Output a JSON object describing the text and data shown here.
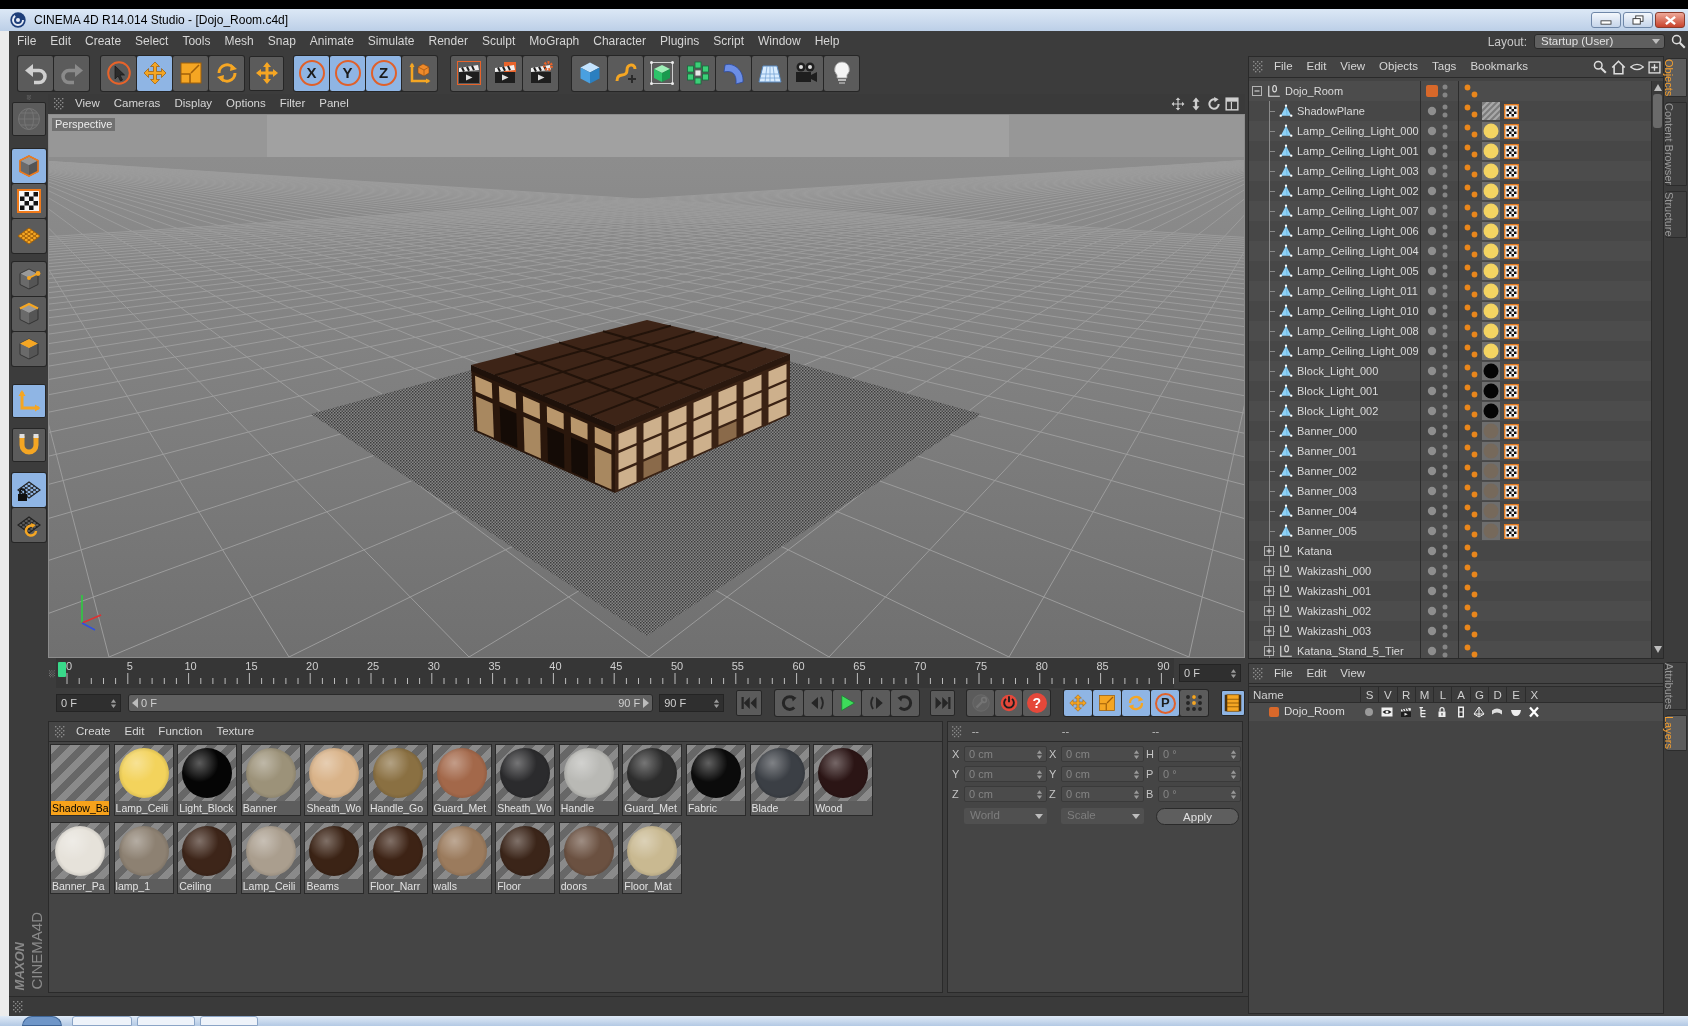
{
  "window": {
    "title": "CINEMA 4D R14.014 Studio - [Dojo_Room.c4d]"
  },
  "menu_bar": [
    "File",
    "Edit",
    "Create",
    "Select",
    "Tools",
    "Mesh",
    "Snap",
    "Animate",
    "Simulate",
    "Render",
    "Sculpt",
    "MoGraph",
    "Character",
    "Plugins",
    "Script",
    "Window",
    "Help"
  ],
  "layout": {
    "label": "Layout:",
    "value": "Startup (User)"
  },
  "main_toolbar": [
    [
      {
        "kind": "undo",
        "on": false,
        "disabled": false
      },
      {
        "kind": "redo",
        "on": false,
        "disabled": true
      }
    ],
    [
      {
        "kind": "select",
        "on": false,
        "disabled": false
      },
      {
        "kind": "move",
        "on": true,
        "disabled": false
      },
      {
        "kind": "scale",
        "on": false,
        "disabled": false
      },
      {
        "kind": "rotate",
        "on": false,
        "disabled": false
      }
    ],
    [
      {
        "kind": "addmove",
        "on": false,
        "disabled": false
      }
    ],
    [
      {
        "kind": "axis",
        "label": "X",
        "on": true,
        "disabled": false
      },
      {
        "kind": "axis",
        "label": "Y",
        "on": true,
        "disabled": false
      },
      {
        "kind": "axis",
        "label": "Z",
        "on": true,
        "disabled": false
      },
      {
        "kind": "coords",
        "on": false,
        "disabled": false
      }
    ],
    [
      {
        "kind": "renderview",
        "on": false,
        "disabled": false
      },
      {
        "kind": "renderpicture",
        "on": false,
        "disabled": false
      },
      {
        "kind": "rendersettings",
        "on": false,
        "disabled": false
      }
    ],
    [
      {
        "kind": "cube",
        "on": false,
        "disabled": false
      },
      {
        "kind": "pen",
        "on": false,
        "disabled": false
      },
      {
        "kind": "subdivision",
        "on": false,
        "disabled": false
      },
      {
        "kind": "cloner",
        "on": false,
        "disabled": false
      },
      {
        "kind": "deformer",
        "on": false,
        "disabled": false
      },
      {
        "kind": "floor",
        "on": false,
        "disabled": false
      },
      {
        "kind": "camera",
        "on": false,
        "disabled": false
      },
      {
        "kind": "light",
        "on": false,
        "disabled": false
      }
    ]
  ],
  "left_toolbar": [
    [
      {
        "kind": "editable",
        "on": false,
        "disabled": true
      }
    ],
    [
      {
        "kind": "model",
        "on": true,
        "disabled": false
      },
      {
        "kind": "texture",
        "on": false,
        "disabled": false
      },
      {
        "kind": "workplane",
        "on": false,
        "disabled": false
      }
    ],
    [
      {
        "kind": "points",
        "on": false,
        "disabled": false
      },
      {
        "kind": "edges",
        "on": false,
        "disabled": false
      },
      {
        "kind": "polygons",
        "on": false,
        "disabled": false
      }
    ],
    [
      {
        "kind": "axes",
        "on": true,
        "disabled": false
      }
    ],
    [
      {
        "kind": "snap",
        "on": false,
        "disabled": false
      }
    ],
    [
      {
        "kind": "lockplane",
        "on": true,
        "disabled": false
      },
      {
        "kind": "sync",
        "on": false,
        "disabled": false
      }
    ]
  ],
  "viewport": {
    "menu": [
      "View",
      "Cameras",
      "Display",
      "Options",
      "Filter",
      "Panel"
    ],
    "camera": "Perspective"
  },
  "timeline": {
    "ticks": [
      "0",
      "5",
      "10",
      "15",
      "20",
      "25",
      "30",
      "35",
      "40",
      "45",
      "50",
      "55",
      "60",
      "65",
      "70",
      "75",
      "80",
      "85",
      "90"
    ],
    "level": 0,
    "frame_field": "0 F"
  },
  "frame_controls": {
    "start_field": "0 F",
    "range": {
      "start": "0 F",
      "end": "90 F",
      "level": 1
    },
    "end_field": "90 F",
    "groups": [
      [
        {
          "kind": "start",
          "on": false,
          "disabled": false
        }
      ],
      [
        {
          "kind": "loopback",
          "on": false,
          "disabled": false
        },
        {
          "kind": "stepback",
          "on": false,
          "disabled": false
        },
        {
          "kind": "play",
          "on": false,
          "disabled": false
        },
        {
          "kind": "stepforward",
          "on": false,
          "disabled": false
        },
        {
          "kind": "loopforward",
          "on": false,
          "disabled": false
        }
      ],
      [
        {
          "kind": "end",
          "on": false,
          "disabled": false
        }
      ],
      [
        {
          "kind": "keyframe",
          "on": false,
          "disabled": true
        },
        {
          "kind": "record",
          "on": false,
          "disabled": false
        },
        {
          "kind": "autokey",
          "label": "?",
          "on": false,
          "disabled": false
        }
      ],
      [
        {
          "kind": "keymove",
          "on": true,
          "disabled": false
        },
        {
          "kind": "keyscale",
          "on": true,
          "disabled": false
        },
        {
          "kind": "keyrotate",
          "on": true,
          "disabled": false
        },
        {
          "kind": "keyparam",
          "label": "P",
          "on": true,
          "disabled": false
        },
        {
          "kind": "keypoints",
          "on": false,
          "disabled": false
        }
      ],
      [
        {
          "kind": "timeline",
          "on": true,
          "disabled": false
        }
      ]
    ]
  },
  "materials": {
    "menu": [
      "Create",
      "Edit",
      "Function",
      "Texture"
    ],
    "items": [
      {
        "name": "Shadow_Ba",
        "selected": true
      },
      {
        "name": "Lamp_Ceili",
        "selected": false,
        "color": "#f3d35c"
      },
      {
        "name": "Light_Block",
        "selected": false,
        "color": "#050505"
      },
      {
        "name": "Banner",
        "selected": false,
        "color": "#9c9279"
      },
      {
        "name": "Sheath_Wo",
        "selected": false,
        "color": "#d9b389"
      },
      {
        "name": "Handle_Go",
        "selected": false,
        "color": "#8a7042"
      },
      {
        "name": "Guard_Met",
        "selected": false,
        "color": "#a3684a"
      },
      {
        "name": "Sheath_Wo",
        "selected": false,
        "color": "#2b2b2d"
      },
      {
        "name": "Handle",
        "selected": false,
        "color": "#b9b9b5"
      },
      {
        "name": "Guard_Met",
        "selected": false,
        "color": "#2d2d2d"
      },
      {
        "name": "Fabric",
        "selected": false,
        "color": "#0b0b0b"
      },
      {
        "name": "Blade",
        "selected": false,
        "color": "#3b3f45"
      },
      {
        "name": "Wood",
        "selected": false,
        "color": "#2b1515"
      },
      {
        "name": "Banner_Pa",
        "selected": false,
        "color": "#e6e2da"
      },
      {
        "name": "lamp_1",
        "selected": false,
        "color": "#8d8172"
      },
      {
        "name": "Ceiling",
        "selected": false,
        "color": "#3d2519"
      },
      {
        "name": "Lamp_Ceili",
        "selected": false,
        "color": "#aa9e8e"
      },
      {
        "name": "Beams",
        "selected": false,
        "color": "#3b2315"
      },
      {
        "name": "Floor_Narr",
        "selected": false,
        "color": "#3d2315"
      },
      {
        "name": "walls",
        "selected": false,
        "color": "#9b7b5d"
      },
      {
        "name": "Floor",
        "selected": false,
        "color": "#3b2519"
      },
      {
        "name": "doors",
        "selected": false,
        "color": "#6b5141"
      },
      {
        "name": "Floor_Mat",
        "selected": false,
        "color": "#c9b991"
      }
    ]
  },
  "coordinates": {
    "columns": [
      {
        "header": "--",
        "fields": [
          {
            "label": "X",
            "value": "0 cm",
            "disabled": true
          },
          {
            "label": "Y",
            "value": "0 cm",
            "disabled": true
          },
          {
            "label": "Z",
            "value": "0 cm",
            "disabled": true
          }
        ],
        "control": {
          "kind": "dropdown",
          "value": "World",
          "disabled": true
        }
      },
      {
        "header": "--",
        "fields": [
          {
            "label": "X",
            "value": "0 cm",
            "disabled": true
          },
          {
            "label": "Y",
            "value": "0 cm",
            "disabled": true
          },
          {
            "label": "Z",
            "value": "0 cm",
            "disabled": true
          }
        ],
        "control": {
          "kind": "dropdown",
          "value": "Scale",
          "disabled": true
        }
      },
      {
        "header": "--",
        "fields": [
          {
            "label": "H",
            "value": "0 °",
            "disabled": true
          },
          {
            "label": "P",
            "value": "0 °",
            "disabled": true
          },
          {
            "label": "B",
            "value": "0 °",
            "disabled": true
          }
        ],
        "control": {
          "kind": "button",
          "value": "Apply",
          "disabled": false
        }
      }
    ]
  },
  "objects": {
    "menu": [
      "File",
      "Edit",
      "View",
      "Objects",
      "Tags",
      "Bookmarks"
    ],
    "tree": [
      {
        "name": "Dojo_Room",
        "kind": "null",
        "expanded": true,
        "color": "#d8682a",
        "tags": [
          {
            "kind": "phong"
          }
        ],
        "children": [
          {
            "name": "ShadowPlane",
            "kind": "polygon",
            "tags": [
              {
                "kind": "phong"
              },
              {
                "kind": "shadow"
              },
              {
                "kind": "texture"
              }
            ]
          },
          {
            "name": "Lamp_Ceiling_Light_000",
            "kind": "polygon",
            "tags": [
              {
                "kind": "phong"
              },
              {
                "kind": "material",
                "color": "#f4d462"
              },
              {
                "kind": "texture"
              }
            ]
          },
          {
            "name": "Lamp_Ceiling_Light_001",
            "kind": "polygon",
            "tags": [
              {
                "kind": "phong"
              },
              {
                "kind": "material",
                "color": "#f4d462"
              },
              {
                "kind": "texture"
              }
            ]
          },
          {
            "name": "Lamp_Ceiling_Light_003",
            "kind": "polygon",
            "tags": [
              {
                "kind": "phong"
              },
              {
                "kind": "material",
                "color": "#f4d462"
              },
              {
                "kind": "texture"
              }
            ]
          },
          {
            "name": "Lamp_Ceiling_Light_002",
            "kind": "polygon",
            "tags": [
              {
                "kind": "phong"
              },
              {
                "kind": "material",
                "color": "#f4d462"
              },
              {
                "kind": "texture"
              }
            ]
          },
          {
            "name": "Lamp_Ceiling_Light_007",
            "kind": "polygon",
            "tags": [
              {
                "kind": "phong"
              },
              {
                "kind": "material",
                "color": "#f4d462"
              },
              {
                "kind": "texture"
              }
            ]
          },
          {
            "name": "Lamp_Ceiling_Light_006",
            "kind": "polygon",
            "tags": [
              {
                "kind": "phong"
              },
              {
                "kind": "material",
                "color": "#f4d462"
              },
              {
                "kind": "texture"
              }
            ]
          },
          {
            "name": "Lamp_Ceiling_Light_004",
            "kind": "polygon",
            "tags": [
              {
                "kind": "phong"
              },
              {
                "kind": "material",
                "color": "#f4d462"
              },
              {
                "kind": "texture"
              }
            ]
          },
          {
            "name": "Lamp_Ceiling_Light_005",
            "kind": "polygon",
            "tags": [
              {
                "kind": "phong"
              },
              {
                "kind": "material",
                "color": "#f4d462"
              },
              {
                "kind": "texture"
              }
            ]
          },
          {
            "name": "Lamp_Ceiling_Light_011",
            "kind": "polygon",
            "tags": [
              {
                "kind": "phong"
              },
              {
                "kind": "material",
                "color": "#f4d462"
              },
              {
                "kind": "texture"
              }
            ]
          },
          {
            "name": "Lamp_Ceiling_Light_010",
            "kind": "polygon",
            "tags": [
              {
                "kind": "phong"
              },
              {
                "kind": "material",
                "color": "#f4d462"
              },
              {
                "kind": "texture"
              }
            ]
          },
          {
            "name": "Lamp_Ceiling_Light_008",
            "kind": "polygon",
            "tags": [
              {
                "kind": "phong"
              },
              {
                "kind": "material",
                "color": "#f4d462"
              },
              {
                "kind": "texture"
              }
            ]
          },
          {
            "name": "Lamp_Ceiling_Light_009",
            "kind": "polygon",
            "tags": [
              {
                "kind": "phong"
              },
              {
                "kind": "material",
                "color": "#f4d462"
              },
              {
                "kind": "texture"
              }
            ]
          },
          {
            "name": "Block_Light_000",
            "kind": "polygon",
            "tags": [
              {
                "kind": "phong"
              },
              {
                "kind": "material",
                "color": "#050505"
              },
              {
                "kind": "texture"
              }
            ]
          },
          {
            "name": "Block_Light_001",
            "kind": "polygon",
            "tags": [
              {
                "kind": "phong"
              },
              {
                "kind": "material",
                "color": "#050505"
              },
              {
                "kind": "texture"
              }
            ]
          },
          {
            "name": "Block_Light_002",
            "kind": "polygon",
            "tags": [
              {
                "kind": "phong"
              },
              {
                "kind": "material",
                "color": "#050505"
              },
              {
                "kind": "texture"
              }
            ]
          },
          {
            "name": "Banner_000",
            "kind": "polygon",
            "tags": [
              {
                "kind": "phong"
              },
              {
                "kind": "material",
                "color": "#76695b"
              },
              {
                "kind": "texture"
              }
            ]
          },
          {
            "name": "Banner_001",
            "kind": "polygon",
            "tags": [
              {
                "kind": "phong"
              },
              {
                "kind": "material",
                "color": "#76695b"
              },
              {
                "kind": "texture"
              }
            ]
          },
          {
            "name": "Banner_002",
            "kind": "polygon",
            "tags": [
              {
                "kind": "phong"
              },
              {
                "kind": "material",
                "color": "#76695b"
              },
              {
                "kind": "texture"
              }
            ]
          },
          {
            "name": "Banner_003",
            "kind": "polygon",
            "tags": [
              {
                "kind": "phong"
              },
              {
                "kind": "material",
                "color": "#76695b"
              },
              {
                "kind": "texture"
              }
            ]
          },
          {
            "name": "Banner_004",
            "kind": "polygon",
            "tags": [
              {
                "kind": "phong"
              },
              {
                "kind": "material",
                "color": "#76695b"
              },
              {
                "kind": "texture"
              }
            ]
          },
          {
            "name": "Banner_005",
            "kind": "polygon",
            "tags": [
              {
                "kind": "phong"
              },
              {
                "kind": "material",
                "color": "#76695b"
              },
              {
                "kind": "texture"
              }
            ]
          },
          {
            "name": "Katana",
            "kind": "null",
            "expanded": false,
            "tags": [
              {
                "kind": "phong"
              }
            ]
          },
          {
            "name": "Wakizashi_000",
            "kind": "null",
            "expanded": false,
            "tags": [
              {
                "kind": "phong"
              }
            ]
          },
          {
            "name": "Wakizashi_001",
            "kind": "null",
            "expanded": false,
            "tags": [
              {
                "kind": "phong"
              }
            ]
          },
          {
            "name": "Wakizashi_002",
            "kind": "null",
            "expanded": false,
            "tags": [
              {
                "kind": "phong"
              }
            ]
          },
          {
            "name": "Wakizashi_003",
            "kind": "null",
            "expanded": false,
            "tags": [
              {
                "kind": "phong"
              }
            ]
          },
          {
            "name": "Katana_Stand_5_Tier",
            "kind": "null",
            "expanded": false,
            "tags": [
              {
                "kind": "phong"
              }
            ]
          }
        ]
      }
    ]
  },
  "layers": {
    "menu": [
      "File",
      "Edit",
      "View"
    ],
    "columns": [
      "Name",
      "S",
      "V",
      "R",
      "M",
      "L",
      "A",
      "G",
      "D",
      "E",
      "X"
    ],
    "rows": [
      {
        "name": "Dojo_Room",
        "color": "#d8682a"
      }
    ]
  },
  "side_tabs_top": [
    {
      "label": "Objects",
      "selected": true
    },
    {
      "label": "Content Browser",
      "selected": false
    },
    {
      "label": "Structure",
      "selected": false
    }
  ],
  "side_tabs_bottom": [
    {
      "label": "Attributes",
      "selected": false
    },
    {
      "label": "Layers",
      "selected": true
    }
  ],
  "logo": [
    "MAXON",
    "CINEMA4D"
  ]
}
